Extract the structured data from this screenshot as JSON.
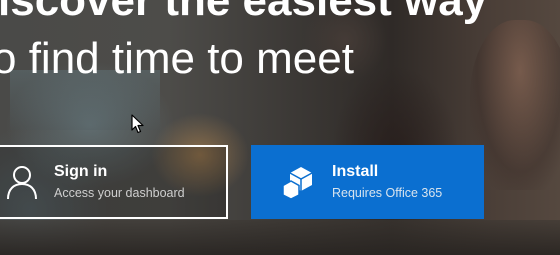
{
  "hero": {
    "headline_line1": "iscover the easiest way",
    "headline_line2": "o find time to meet"
  },
  "actions": {
    "signin": {
      "title": "Sign in",
      "subtitle": "Access your dashboard",
      "icon": "person-icon"
    },
    "install": {
      "title": "Install",
      "subtitle": "Requires Office 365",
      "icon": "cube-icon"
    }
  },
  "colors": {
    "accent": "#0b6fd0",
    "text": "#ffffff"
  }
}
